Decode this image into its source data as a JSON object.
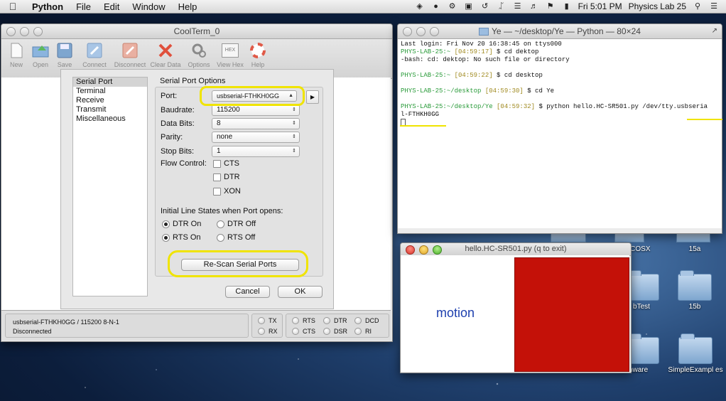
{
  "menubar": {
    "app": "Python",
    "items": [
      "File",
      "Edit",
      "Window",
      "Help"
    ],
    "clock": "Fri 5:01 PM",
    "user": "Physics Lab 25"
  },
  "coolterm": {
    "title": "CoolTerm_0",
    "toolbar": [
      "New",
      "Open",
      "Save",
      "Connect",
      "Disconnect",
      "Clear Data",
      "Options",
      "View Hex",
      "Help"
    ],
    "hex_label": "HEX",
    "sidebar": [
      "Serial Port",
      "Terminal",
      "Receive",
      "Transmit",
      "Miscellaneous"
    ],
    "group_title": "Serial Port Options",
    "port_label": "Port:",
    "port_value": "usbserial-FTHKH0GG",
    "baud_label": "Baudrate:",
    "baud_value": "115200",
    "databits_label": "Data Bits:",
    "databits_value": "8",
    "parity_label": "Parity:",
    "parity_value": "none",
    "stopbits_label": "Stop Bits:",
    "stopbits_value": "1",
    "flow_label": "Flow Control:",
    "flow": [
      "CTS",
      "DTR",
      "XON"
    ],
    "initial_label": "Initial Line States when Port opens:",
    "dtr_on": "DTR On",
    "dtr_off": "DTR Off",
    "rts_on": "RTS On",
    "rts_off": "RTS Off",
    "rescan": "Re-Scan Serial Ports",
    "cancel": "Cancel",
    "ok": "OK",
    "status_line1": "usbserial-FTHKH0GG / 115200 8-N-1",
    "status_line2": "Disconnected",
    "leds": [
      "TX",
      "RX",
      "RTS",
      "CTS",
      "DTR",
      "DSR",
      "DCD",
      "RI"
    ]
  },
  "terminal": {
    "title": "Ye — ~/desktop/Ye — Python — 80×24",
    "lines": [
      {
        "p": "",
        "t": "",
        "c": "Last login: Fri Nov 20 16:38:45 on ttys000"
      },
      {
        "p": "PHYS-LAB-25:~",
        "t": "[04:59:17]",
        "c": " $ cd dektop"
      },
      {
        "p": "",
        "t": "",
        "c": "-bash: cd: dektop: No such file or directory"
      },
      {
        "p": "",
        "t": "",
        "c": ""
      },
      {
        "p": "PHYS-LAB-25:~",
        "t": "[04:59:22]",
        "c": " $ cd desktop"
      },
      {
        "p": "",
        "t": "",
        "c": ""
      },
      {
        "p": "PHYS-LAB-25:~/desktop",
        "t": "[04:59:30]",
        "c": " $ cd Ye"
      },
      {
        "p": "",
        "t": "",
        "c": ""
      },
      {
        "p": "PHYS-LAB-25:~/desktop/Ye",
        "t": "[04:59:32]",
        "c": " $ python hello.HC-SR501.py /dev/tty.usbseria"
      },
      {
        "p": "",
        "t": "",
        "c": "l-FTHKH0GG"
      }
    ]
  },
  "hello": {
    "title": "hello.HC-SR501.py (q to exit)",
    "motion": "motion"
  },
  "desktop": {
    "icons": [
      "ACOSX",
      "15a",
      "bTest",
      "15b",
      "firmware",
      "SimpleExampl es"
    ]
  }
}
